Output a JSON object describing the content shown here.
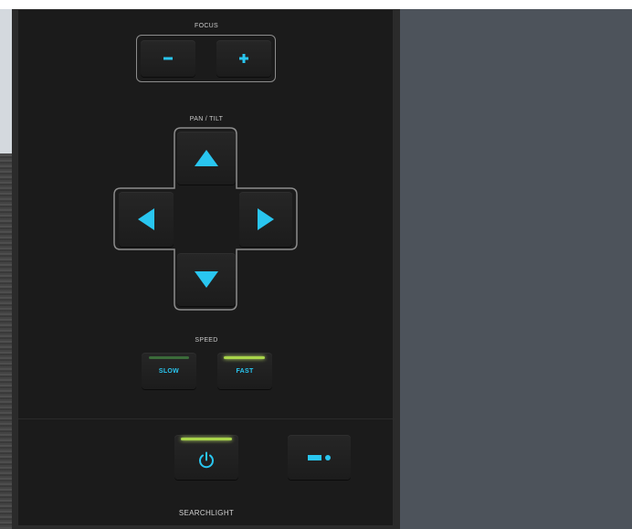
{
  "colors": {
    "accent": "#29c6f0",
    "panel_bg": "#1b1b1b",
    "key_bg": "#232323",
    "outline": "#8c8c8c",
    "led_active": "#a9d64a",
    "led_idle": "#3b6b3a",
    "page_bg": "#4d535b"
  },
  "focus": {
    "label": "FOCUS",
    "minus_icon": "minus-icon",
    "plus_icon": "plus-icon"
  },
  "pan_tilt": {
    "label": "PAN / TILT",
    "up_icon": "arrow-up-icon",
    "down_icon": "arrow-down-icon",
    "left_icon": "arrow-left-icon",
    "right_icon": "arrow-right-icon"
  },
  "speed": {
    "label": "SPEED",
    "slow_label": "SLOW",
    "fast_label": "FAST",
    "selected": "FAST"
  },
  "searchlight": {
    "label": "SEARCHLIGHT",
    "power_icon": "power-icon",
    "mode_icon": "beam-icon",
    "power_on": true
  }
}
